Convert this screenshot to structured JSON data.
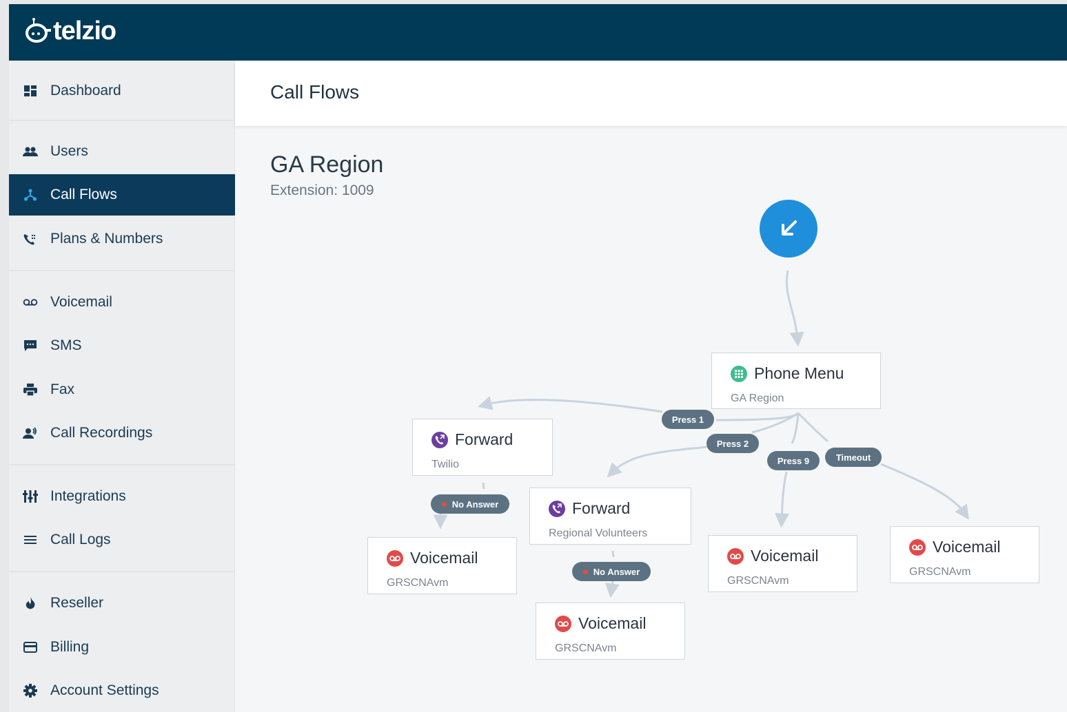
{
  "brand": {
    "name": "telzio"
  },
  "colors": {
    "topbar": "#003a57",
    "active_nav": "#0b3a5a",
    "accent": "#1f8fdc",
    "phone_menu": "#3dbd8e",
    "forward": "#6b3fa0",
    "voicemail": "#e24a4a",
    "pill": "#5c7282",
    "connector": "#c8d3dd"
  },
  "sidebar": {
    "items": [
      {
        "label": "Dashboard",
        "icon": "dashboard-icon",
        "active": false
      },
      {
        "label": "Users",
        "icon": "users-icon",
        "active": false
      },
      {
        "label": "Call Flows",
        "icon": "call-flows-icon",
        "active": true
      },
      {
        "label": "Plans & Numbers",
        "icon": "phone-numbers-icon",
        "active": false
      },
      {
        "label": "Voicemail",
        "icon": "voicemail-icon",
        "active": false
      },
      {
        "label": "SMS",
        "icon": "sms-icon",
        "active": false
      },
      {
        "label": "Fax",
        "icon": "fax-icon",
        "active": false
      },
      {
        "label": "Call Recordings",
        "icon": "call-recordings-icon",
        "active": false
      },
      {
        "label": "Integrations",
        "icon": "integrations-icon",
        "active": false
      },
      {
        "label": "Call Logs",
        "icon": "call-logs-icon",
        "active": false
      },
      {
        "label": "Reseller",
        "icon": "reseller-icon",
        "active": false
      },
      {
        "label": "Billing",
        "icon": "billing-icon",
        "active": false
      },
      {
        "label": "Account Settings",
        "icon": "gear-icon",
        "active": false
      }
    ]
  },
  "page": {
    "title": "Call Flows"
  },
  "flow": {
    "name": "GA Region",
    "extension": "Extension: 1009",
    "start_icon": "incoming-call-arrow-icon",
    "nodes": {
      "phone_menu": {
        "title": "Phone Menu",
        "subtitle": "GA Region",
        "icon": "keypad-icon"
      },
      "forward_twilio": {
        "title": "Forward",
        "subtitle": "Twilio",
        "icon": "forward-call-icon"
      },
      "forward_regional": {
        "title": "Forward",
        "subtitle": "Regional Volunteers",
        "icon": "forward-call-icon"
      },
      "vm_twilio": {
        "title": "Voicemail",
        "subtitle": "GRSCNAvm",
        "icon": "voicemail-icon"
      },
      "vm_regional": {
        "title": "Voicemail",
        "subtitle": "GRSCNAvm",
        "icon": "voicemail-icon"
      },
      "vm_press9": {
        "title": "Voicemail",
        "subtitle": "GRSCNAvm",
        "icon": "voicemail-icon"
      },
      "vm_timeout": {
        "title": "Voicemail",
        "subtitle": "GRSCNAvm",
        "icon": "voicemail-icon"
      }
    },
    "branches": {
      "press1": "Press 1",
      "press2": "Press 2",
      "press9": "Press 9",
      "timeout": "Timeout",
      "no_answer_1": "No Answer",
      "no_answer_2": "No Answer"
    }
  }
}
